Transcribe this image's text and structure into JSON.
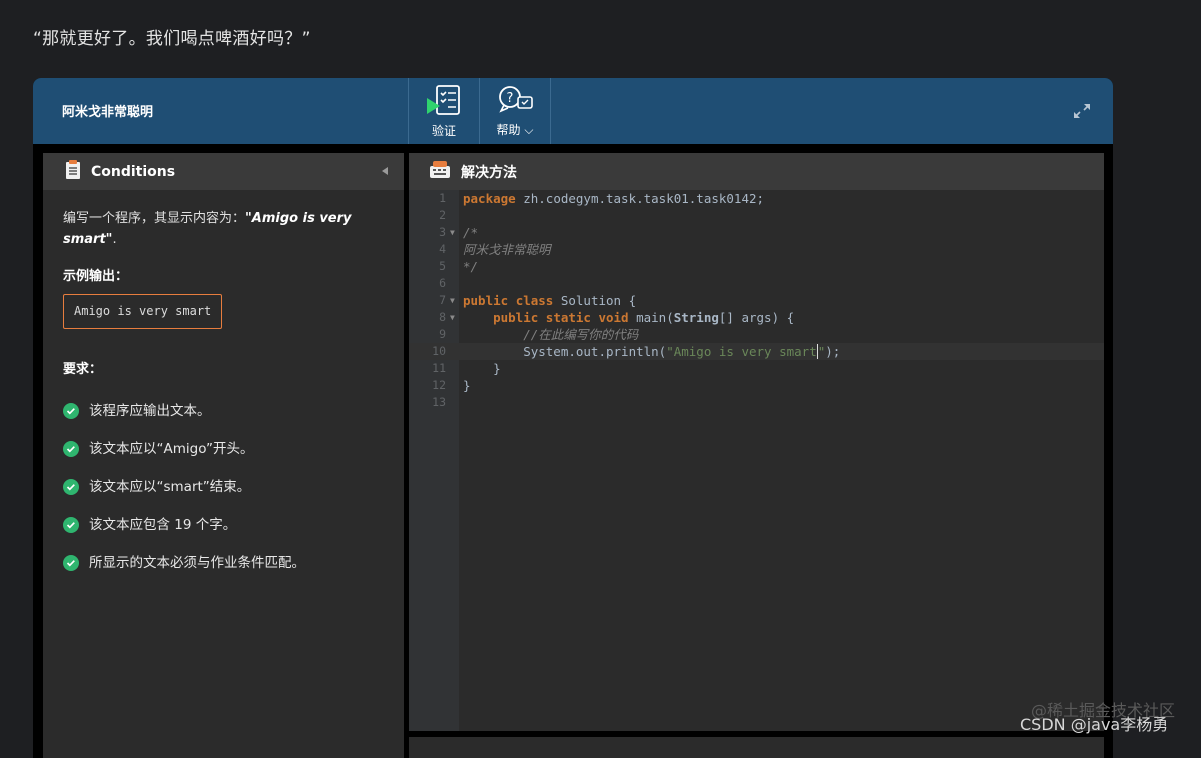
{
  "quote": "“那就更好了。我们喝点啤酒好吗？”",
  "toolbar": {
    "task_title": "阿米戈非常聪明",
    "verify_label": "验证",
    "help_label": "帮助",
    "verify_icon": "checklist-play-icon",
    "help_icon": "help-chat-icon"
  },
  "conditions": {
    "title": "Conditions",
    "intro_prefix": "编写一个程序，其显示内容为：",
    "intro_highlight": "\"Amigo is very smart\"",
    "intro_suffix": ".",
    "sample_title": "示例输出：",
    "sample_output": "Amigo is very smart",
    "requirements_title": "要求：",
    "requirements": [
      "该程序应输出文本。",
      "该文本应以“Amigo”开头。",
      "该文本应以“smart”结束。",
      "该文本应包含 19 个字。",
      "所显示的文本必须与作业条件匹配。"
    ]
  },
  "solution": {
    "title": "解决方法",
    "line_numbers": [
      "1",
      "2",
      "3",
      "4",
      "5",
      "6",
      "7",
      "8",
      "9",
      "10",
      "11",
      "12",
      "13"
    ],
    "code": {
      "l1_kw": "package",
      "l1_rest": " zh.codegym.task.task01.task0142;",
      "l3": "/*",
      "l4": "阿米戈非常聪明",
      "l5": "*/",
      "l7_kw1": "public",
      "l7_kw2": "class",
      "l7_rest": " Solution {",
      "l8_indent": "    ",
      "l8_kw": "public static void",
      "l8_rest": " main(",
      "l8_type": "String",
      "l8_end": "[] args) {",
      "l9": "        //在此编写你的代码",
      "l10_pre": "        System.out.println(",
      "l10_str": "\"Amigo is very smart",
      "l10_str_end": "\"",
      "l10_end": ");",
      "l11": "    }",
      "l12": "}"
    }
  },
  "watermark": {
    "site": "@稀土掘金技术社区",
    "author": "CSDN @java李杨勇"
  },
  "colors": {
    "topbar": "#1f4e74",
    "accent_orange": "#e77d3e",
    "check_green": "#2fb56f",
    "keyword": "#cc7832",
    "string": "#6a8759"
  }
}
